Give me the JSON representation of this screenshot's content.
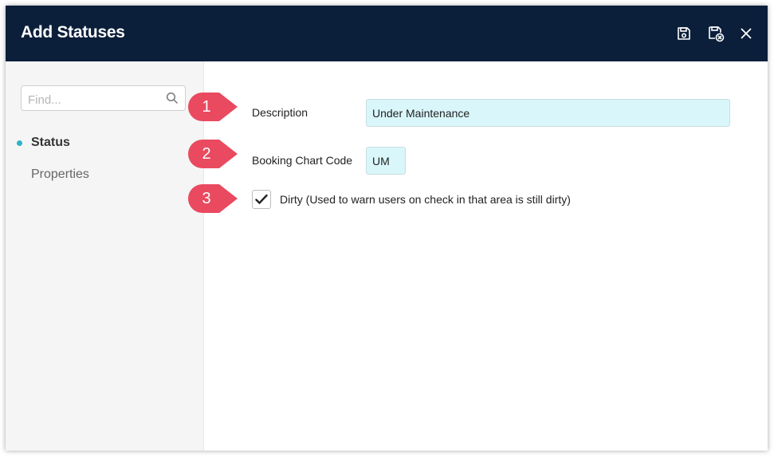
{
  "dialog": {
    "title": "Add Statuses",
    "header_icons": [
      "save-icon",
      "save-close-icon",
      "close-icon"
    ]
  },
  "sidebar": {
    "search_placeholder": "Find...",
    "items": [
      {
        "label": "Status",
        "active": true
      },
      {
        "label": "Properties",
        "active": false
      }
    ]
  },
  "form": {
    "description_label": "Description",
    "description_value": "Under Maintenance",
    "booking_code_label": "Booking Chart Code",
    "booking_code_value": "UM",
    "dirty_checked": true,
    "dirty_label": "Dirty (Used to warn users on check in that area is still dirty)"
  },
  "callouts": [
    "1",
    "2",
    "3"
  ],
  "colors": {
    "header_bg": "#0b1f3a",
    "field_bg": "#d9f7fb",
    "callout": "#e94a60",
    "accent_dot": "#2bb5c9"
  }
}
